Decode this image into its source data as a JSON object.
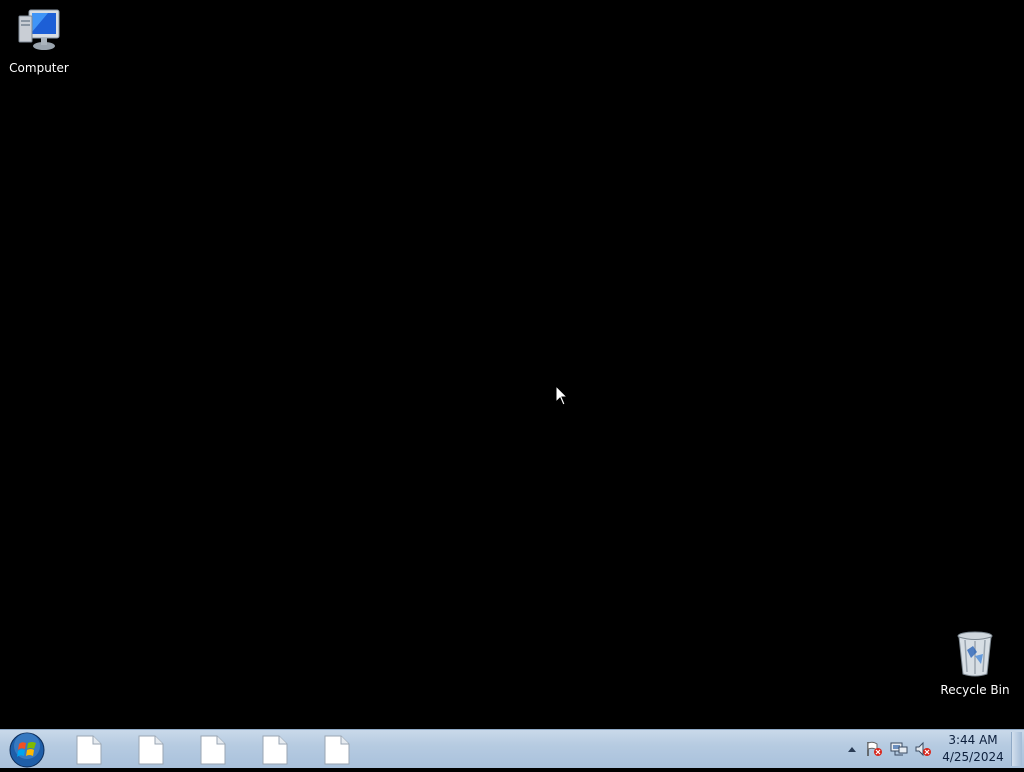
{
  "desktop": {
    "icons": [
      {
        "label": "Computer",
        "icon": "computer-icon"
      },
      {
        "label": "Recycle Bin",
        "icon": "recycle-bin-icon"
      }
    ]
  },
  "taskbar": {
    "start_icon": "windows-start-orb-icon",
    "pinned": [
      {
        "icon": "document-icon"
      },
      {
        "icon": "document-icon"
      },
      {
        "icon": "document-icon"
      },
      {
        "icon": "document-icon"
      },
      {
        "icon": "document-icon"
      }
    ],
    "tray": {
      "icons": [
        "show-hidden-icons-arrow",
        "action-center-flag-icon",
        "network-icon",
        "volume-muted-icon"
      ],
      "time": "3:44 AM",
      "date": "4/25/2024"
    }
  },
  "colors": {
    "desktop_background": "#000000",
    "taskbar": "#b6cbe1"
  }
}
